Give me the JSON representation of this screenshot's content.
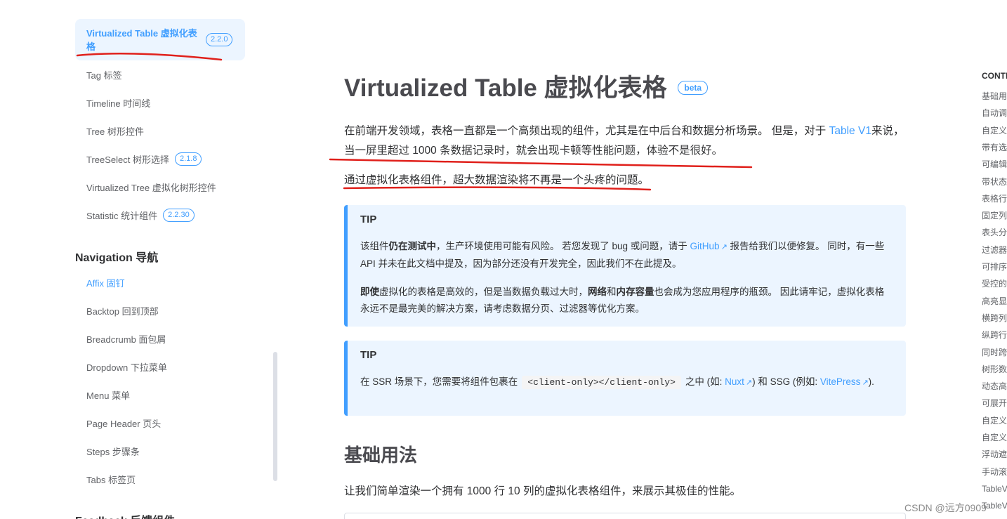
{
  "sidebar": {
    "items": [
      {
        "label": "Virtualized Table 虚拟化表格",
        "badge": "2.2.0"
      },
      {
        "label": "Tag 标签",
        "badge": ""
      },
      {
        "label": "Timeline 时间线",
        "badge": ""
      },
      {
        "label": "Tree 树形控件",
        "badge": ""
      },
      {
        "label": "TreeSelect 树形选择",
        "badge": "2.1.8"
      },
      {
        "label": "Virtualized Tree 虚拟化树形控件",
        "badge": ""
      },
      {
        "label": "Statistic 统计组件",
        "badge": "2.2.30"
      }
    ],
    "navigation_heading": "Navigation 导航",
    "navigation_items": [
      "Affix 固钉",
      "Backtop 回到顶部",
      "Breadcrumb 面包屑",
      "Dropdown 下拉菜单",
      "Menu 菜单",
      "Page Header 页头",
      "Steps 步骤条",
      "Tabs 标签页"
    ],
    "feedback_heading": "Feedback 反馈组件"
  },
  "main": {
    "title": "Virtualized Table 虚拟化表格",
    "title_badge": "beta",
    "intro_part1": "在前端开发领域，表格一直都是一个高频出现的组件，尤其是在中后台和数据分析场景。 但是，对于 ",
    "intro_link": "Table V1",
    "intro_part2": "来说，当一屏里超过 1000 条数据记录时，就会出现卡顿等性能问题，体验不是很好。",
    "intro_second": "通过虚拟化表格组件，超大数据渲染将不再是一个头疼的问题。",
    "tip1": {
      "title": "TIP",
      "p1_a": "该组件",
      "p1_bold": "仍在测试中",
      "p1_b": "，生产环境使用可能有风险。 若您发现了 bug 或问题，请于 ",
      "p1_link": "GitHub",
      "p1_c": " 报告给我们以便修复。 同时，有一些 API 并未在此文档中提及，因为部分还没有开发完全，因此我们不在此提及。",
      "p2_bold1": "即使",
      "p2_a": "虚拟化的表格是高效的，但是当数据负载过大时，",
      "p2_bold2": "网络",
      "p2_b": "和",
      "p2_bold3": "内存容量",
      "p2_c": "也会成为您应用程序的瓶颈。 因此请牢记，虚拟化表格永远不是最完美的解决方案，请考虑数据分页、过滤器等优化方案。"
    },
    "tip2": {
      "title": "TIP",
      "a": "在 SSR 场景下，您需要将组件包裹在",
      "code": "<client-only></client-only>",
      "b": "之中 (如: ",
      "link1": "Nuxt",
      "c": ") 和 SSG (例如: ",
      "link2": "VitePress",
      "d": ")."
    },
    "section_title": "基础用法",
    "section_intro": "让我们简单渲染一个拥有 1000 行 10 列的虚拟化表格组件，来展示其极佳的性能。"
  },
  "toc": {
    "title": "CONTENTS",
    "items": [
      "基础用法",
      "自动调整大小",
      "自定义单元格渲染器",
      "带有选择的表格",
      "可编辑单元格",
      "带状态的表格",
      "表格行高",
      "固定列表格",
      "表头分组",
      "过滤器",
      "可排序表格",
      "受控的排序",
      "高亮显示",
      "横跨列",
      "纵跨行",
      "同时跨行跨列",
      "树形数据",
      "动态高度渲染器",
      "可展开的行",
      "自定义页脚",
      "自定义空元素",
      "浮动遮罩",
      "手动滚动",
      "TableV2 属性",
      "TableV2 插槽"
    ]
  },
  "watermark": "CSDN @远方0909",
  "colors": {
    "accent": "#409eff",
    "tip_bg": "#ecf5ff",
    "annotation": "#e0201b"
  },
  "icons": {
    "external_link": "external-link-icon"
  }
}
